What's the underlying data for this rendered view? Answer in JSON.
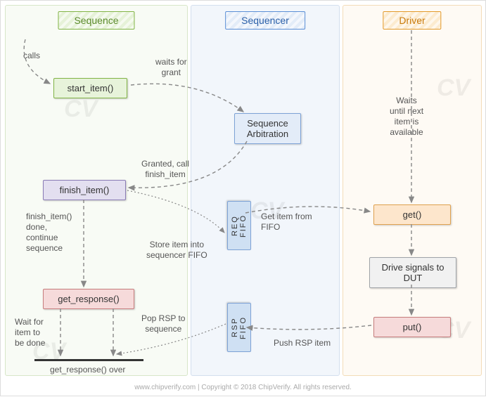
{
  "lanes": {
    "sequence": {
      "title": "Sequence"
    },
    "sequencer": {
      "title": "Sequencer"
    },
    "driver": {
      "title": "Driver"
    }
  },
  "nodes": {
    "start_item": "start_item()",
    "finish_item": "finish_item()",
    "get_response": "get_response()",
    "seq_arb": "Sequence\nArbitration",
    "req_fifo": "REQ  FIFO",
    "rsp_fifo": "RSP  FIFO",
    "get": "get()",
    "drive_dut": "Drive signals to\nDUT",
    "put": "put()"
  },
  "labels": {
    "calls": "calls",
    "waits_for_grant": "waits for\ngrant",
    "granted_call": "Granted, call\nfinish_item",
    "finish_item_done": "finish_item()\ndone,\ncontinue\nsequence",
    "store_item": "Store item into\nsequencer FIFO",
    "wait_item_done": "Wait for\nitem to\nbe done",
    "get_resp_over": "get_response() over",
    "get_item_fifo": "Get item from\nFIFO",
    "waits_until_next": "Waits\nuntil next\nitem is\navailable",
    "pop_rsp": "Pop RSP to\nsequence",
    "push_rsp": "Push RSP item"
  },
  "footer": "www.chipverify.com | Copyright © 2018 ChipVerify. All rights reserved.",
  "watermark": "CV"
}
